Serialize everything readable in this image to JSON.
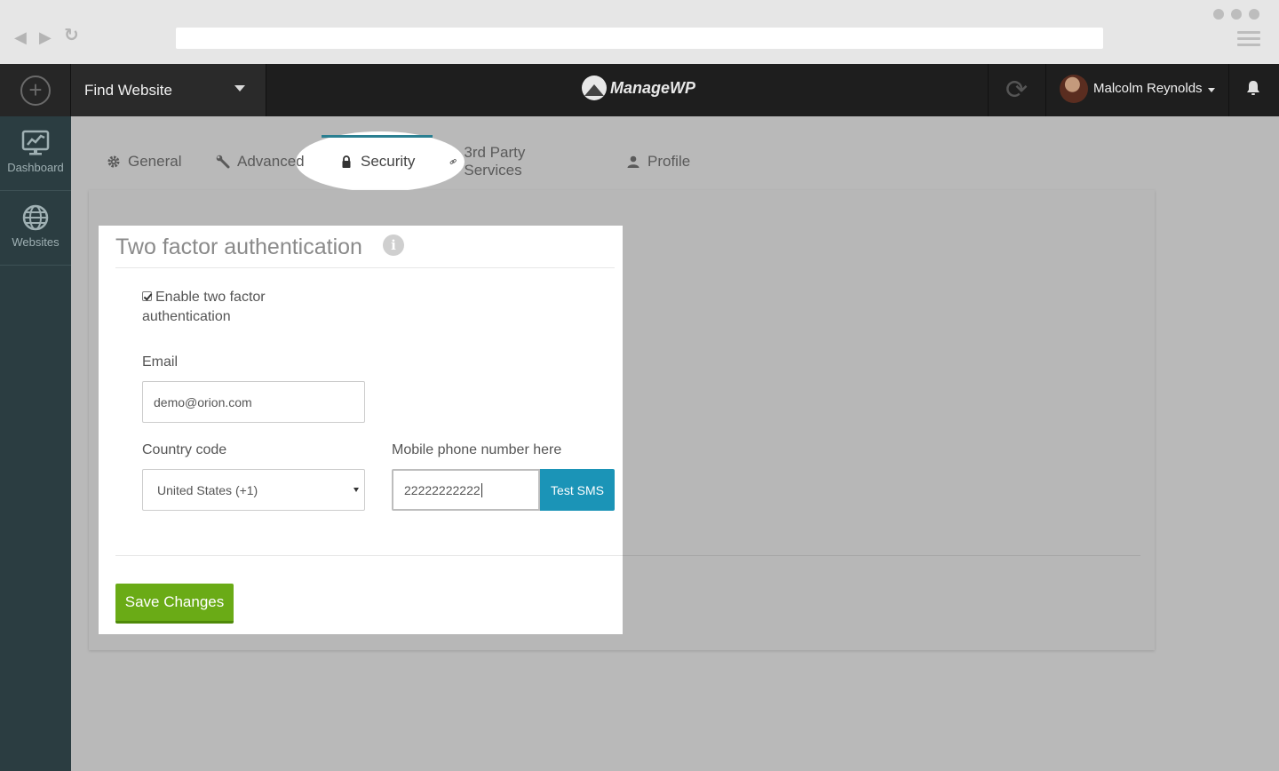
{
  "app": {
    "name": "ManageWP"
  },
  "topbar": {
    "find_website_label": "Find Website",
    "user_name": "Malcolm Reynolds"
  },
  "sidebar": {
    "items": [
      {
        "label": "Dashboard",
        "icon": "dashboard-icon"
      },
      {
        "label": "Websites",
        "icon": "globe-icon"
      }
    ]
  },
  "tabs": [
    {
      "label": "General",
      "icon": "gear-icon"
    },
    {
      "label": "Advanced",
      "icon": "wrench-icon"
    },
    {
      "label": "Security",
      "icon": "lock-icon",
      "active": true
    },
    {
      "label": "3rd Party Services",
      "icon": "link-icon"
    },
    {
      "label": "Profile",
      "icon": "user-icon"
    }
  ],
  "two_factor": {
    "title": "Two factor authentication",
    "enable_label": "Enable two factor authentication",
    "enabled": true,
    "email_label": "Email",
    "email_value": "demo@orion.com",
    "country_label": "Country code",
    "country_value": "United States (+1)",
    "phone_label": "Mobile phone number here",
    "phone_value": "22222222222",
    "test_sms_label": "Test SMS",
    "save_label": "Save Changes"
  },
  "colors": {
    "accent_teal": "#2a7f91",
    "test_sms_blue": "#1b94b7",
    "save_green": "#6aab16",
    "sidebar_bg": "#2b3d41",
    "topbar_bg": "#1e1e1e"
  }
}
